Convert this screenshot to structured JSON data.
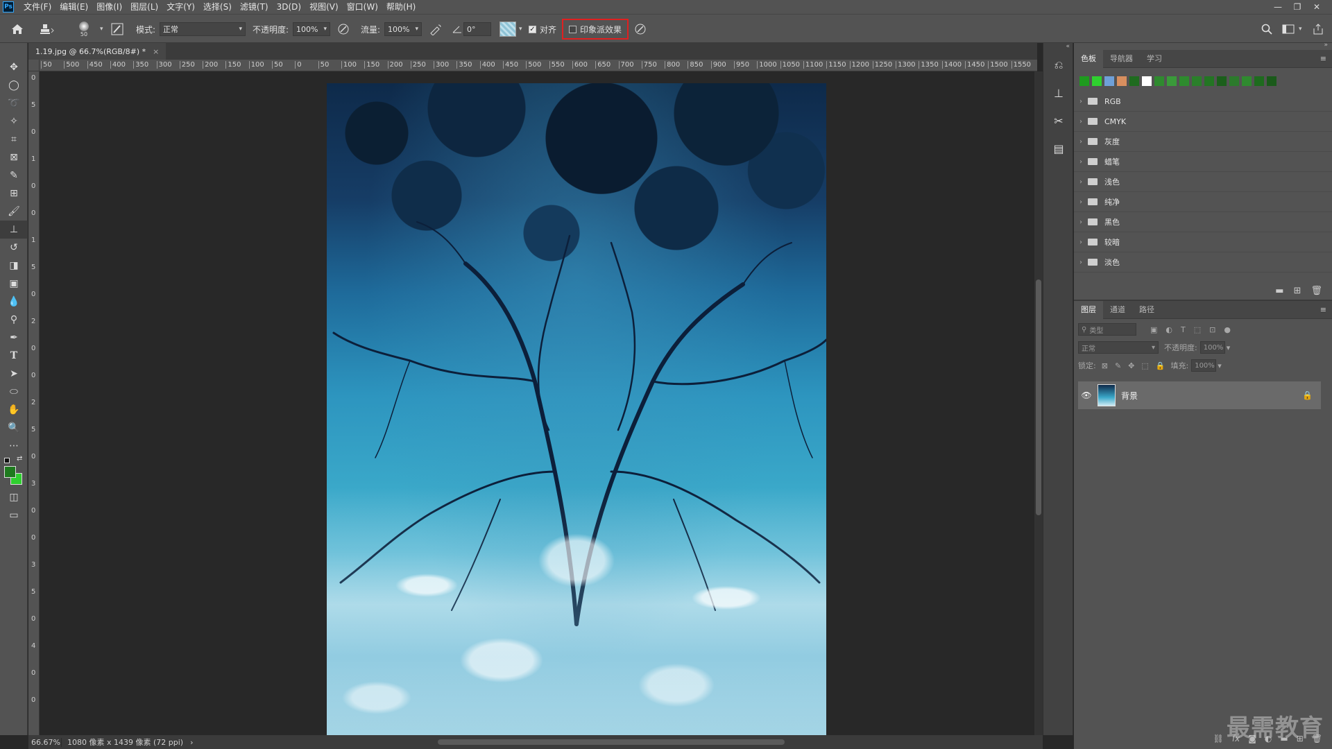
{
  "menubar": {
    "logo": "Ps",
    "items": [
      "文件(F)",
      "编辑(E)",
      "图像(I)",
      "图层(L)",
      "文字(Y)",
      "选择(S)",
      "滤镜(T)",
      "3D(D)",
      "视图(V)",
      "窗口(W)",
      "帮助(H)"
    ],
    "window_controls": [
      "—",
      "❐",
      "✕"
    ]
  },
  "options": {
    "brush_size": "50",
    "mode_label": "模式:",
    "mode_value": "正常",
    "opacity_label": "不透明度:",
    "opacity_value": "100%",
    "flow_label": "流量:",
    "flow_value": "100%",
    "angle_value": "0°",
    "aligned_label": "对齐",
    "aligned_checked": true,
    "impressionist_label": "印象派效果",
    "impressionist_checked": false
  },
  "document": {
    "tab_title": "1.19.jpg @ 66.7%(RGB/8#) *",
    "close": "×"
  },
  "ruler": {
    "h_labels": [
      "50",
      "500",
      "450",
      "400",
      "350",
      "300",
      "250",
      "200",
      "150",
      "100",
      "50",
      "0",
      "50",
      "100",
      "150",
      "200",
      "250",
      "300",
      "350",
      "400",
      "450",
      "500",
      "550",
      "600",
      "650",
      "700",
      "750",
      "800",
      "850",
      "900",
      "950",
      "1000",
      "1050",
      "1100",
      "1150",
      "1200",
      "1250",
      "1300",
      "1350",
      "1400",
      "1450",
      "1500",
      "1550"
    ],
    "v_labels": [
      "0",
      "5",
      "0",
      "1",
      "0",
      "0",
      "1",
      "5",
      "0",
      "2",
      "0",
      "0",
      "2",
      "5",
      "0",
      "3",
      "0",
      "0",
      "3",
      "5",
      "0",
      "4",
      "0",
      "0"
    ]
  },
  "status": {
    "zoom": "66.67%",
    "info": "1080 像素 x 1439 像素 (72 ppi)",
    "arrow": "›"
  },
  "swatches_panel": {
    "tabs": [
      "色板",
      "导航器",
      "学习"
    ],
    "menu": "≡",
    "colors": [
      "#1e9a1e",
      "#2fd02f",
      "#6fa0d8",
      "#d88f5f",
      "#1f6b1f",
      "#ffffff",
      "#2f8a2f",
      "#3a9a3a",
      "#2e8b2e",
      "#2a7f2a",
      "#237523",
      "#1b5f1b",
      "#2c7a2c",
      "#2f8a2f",
      "#1e6b1e",
      "#1a5a1a"
    ],
    "groups": [
      "RGB",
      "CMYK",
      "灰度",
      "蜡笔",
      "浅色",
      "纯净",
      "黑色",
      "较暗",
      "淡色"
    ],
    "footer_icons": [
      "folder-icon",
      "new-swatch-icon",
      "trash-icon"
    ]
  },
  "layers_panel": {
    "tabs": [
      "图层",
      "通道",
      "路径"
    ],
    "menu": "≡",
    "search_placeholder": "类型",
    "blend_mode": "正常",
    "opacity_label": "不透明度:",
    "opacity_value": "100%",
    "lock_label": "锁定:",
    "fill_label": "填充:",
    "fill_value": "100%",
    "layers": [
      {
        "name": "背景",
        "visible": true,
        "locked": true
      }
    ],
    "footer_icons": [
      "link-icon",
      "fx-icon",
      "mask-icon",
      "adjustment-icon",
      "group-icon",
      "new-layer-icon",
      "trash-icon"
    ],
    "footer_fx": "fx"
  },
  "watermark": "最需教育"
}
